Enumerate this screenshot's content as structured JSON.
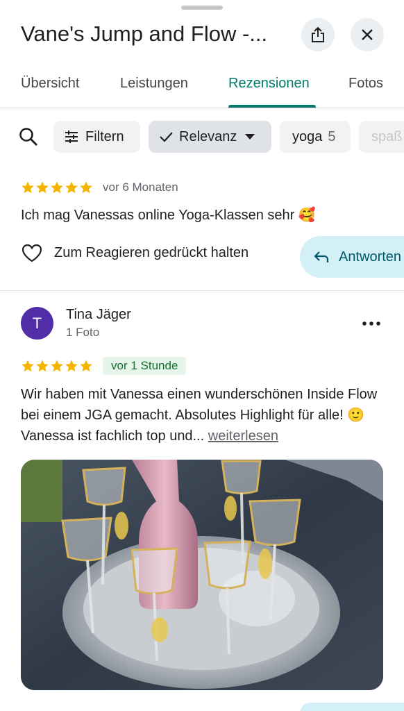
{
  "header": {
    "title": "Vane's Jump and Flow -...",
    "share_icon": "share-icon",
    "close_icon": "close-icon"
  },
  "tabs": [
    {
      "label": "Übersicht",
      "active": false
    },
    {
      "label": "Leistungen",
      "active": false
    },
    {
      "label": "Rezensionen",
      "active": true
    },
    {
      "label": "Fotos",
      "active": false
    }
  ],
  "filters": {
    "search_icon": "search-icon",
    "filter_label": "Filtern",
    "sort_label": "Relevanz",
    "topic_chip": {
      "label": "yoga",
      "count": "5"
    },
    "partial_chip": "spaß"
  },
  "review1": {
    "rating": 5,
    "time_ago": "vor 6 Monaten",
    "text": "Ich mag Vanessas online Yoga-Klassen sehr 🥰",
    "react_label": "Zum Reagieren gedrückt halten",
    "reply_label": "Antworten"
  },
  "review2": {
    "avatar_letter": "T",
    "author": "Tina Jäger",
    "author_sub": "1 Foto",
    "rating": 5,
    "time_badge": "vor 1 Stunde",
    "text": "Wir haben mit Vanessa einen wunderschönen Inside Flow bei einem JGA gemacht. Absolutes Highlight für alle! 🙂 Vanessa ist fachlich top und...",
    "read_more": "weiterlesen"
  },
  "colors": {
    "accent": "#00796b",
    "star": "#f4b400",
    "avatar": "#512da8",
    "reply_bg": "#d3f0f7"
  }
}
